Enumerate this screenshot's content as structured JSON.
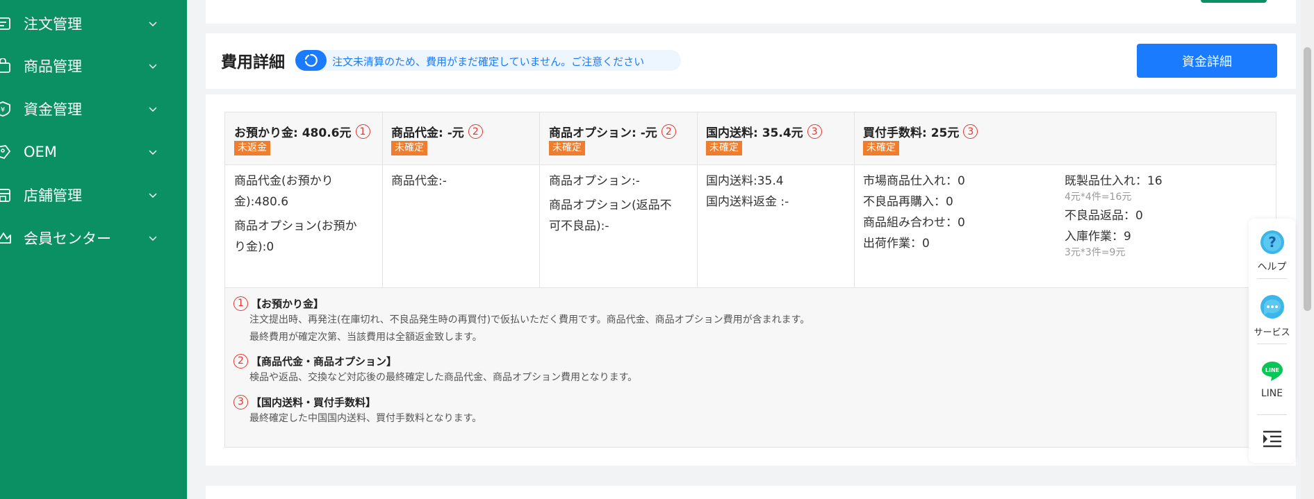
{
  "sidebar": {
    "items": [
      {
        "label": "注文管理",
        "icon": "order-list-icon"
      },
      {
        "label": "商品管理",
        "icon": "shopping-bag-icon"
      },
      {
        "label": "資金管理",
        "icon": "yen-shield-icon"
      },
      {
        "label": "OEM",
        "icon": "badge-icon"
      },
      {
        "label": "店舗管理",
        "icon": "store-icon"
      },
      {
        "label": "会員センター",
        "icon": "crown-icon"
      }
    ]
  },
  "header": {
    "title": "費用詳細",
    "notice": "注文未清算のため、費用がまだ確定していません。ご注意ください",
    "fund_button": "資金詳細"
  },
  "fees": {
    "columns": [
      {
        "title": "お預かり金: 480.6元",
        "num": "1",
        "tag": "未返金",
        "lines": [
          "商品代金(お預かり",
          "金):480.6",
          "商品オプション(お預か",
          "り金):0"
        ]
      },
      {
        "title": "商品代金: -元",
        "num": "2",
        "tag": "未確定",
        "lines": [
          "商品代金:-"
        ]
      },
      {
        "title": "商品オプション: -元",
        "num": "2",
        "tag": "未確定",
        "lines": [
          "商品オプション:-",
          "商品オプション(返品不",
          "可不良品):-"
        ]
      },
      {
        "title": "国内送料: 35.4元",
        "num": "3",
        "tag": "未確定",
        "lines": [
          "国内送料:35.4",
          "国内送料返金 :-"
        ]
      },
      {
        "title": "買付手数料: 25元",
        "num": "3",
        "tag": "未確定",
        "left_lines": [
          "市場商品仕入れ：0",
          "不良品再購入：0",
          "商品組み合わせ：0",
          "出荷作業：0"
        ],
        "right": [
          {
            "label": "既製品仕入れ：16",
            "sub": "4元*4件=16元"
          },
          {
            "label": "不良品返品：0",
            "sub": ""
          },
          {
            "label": "入庫作業：9",
            "sub": "3元*3件=9元"
          }
        ]
      }
    ]
  },
  "notes": [
    {
      "num": "1",
      "title": "【お預かり金】",
      "lines": [
        "注文提出時、再発注(在庫切れ、不良品発生時の再買付)で仮払いただく費用です。商品代金、商品オプション費用が含まれます。",
        "最終費用が確定次第、当該費用は全額返金致します。"
      ]
    },
    {
      "num": "2",
      "title": "【商品代金・商品オプション】",
      "lines": [
        "検品や返品、交換など対応後の最終確定した商品代金、商品オプション費用となります。"
      ]
    },
    {
      "num": "3",
      "title": "【国内送料・買付手数料】",
      "lines": [
        "最終確定した中国国内送料、買付手数料となります。"
      ]
    }
  ],
  "float_panel": {
    "help": "ヘルプ",
    "service": "サービス",
    "line": "LINE"
  },
  "colors": {
    "sidebar": "#0b9063",
    "primary": "#1a7bff",
    "tag": "#ee7d2e",
    "marker": "#e8342e"
  }
}
